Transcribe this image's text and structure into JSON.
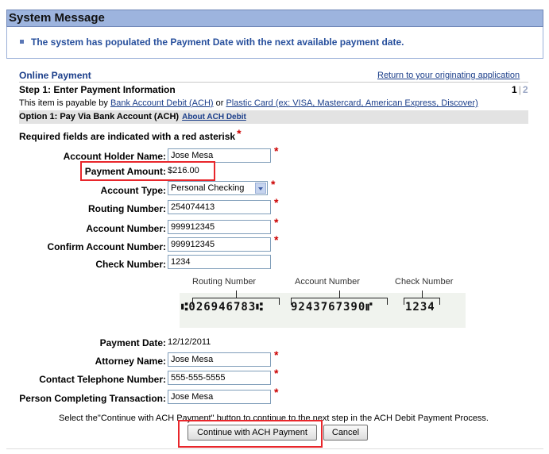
{
  "system_message": {
    "title": "System Message",
    "text": "The system has populated the Payment Date with the next available payment date."
  },
  "online_payment": {
    "title": "Online Payment",
    "return_link": "Return to your originating application",
    "step": "Step 1: Enter Payment Information",
    "page_current": "1",
    "page_sep": "|",
    "page_next": "2",
    "payable_prefix": "This item is payable by ",
    "ach_link": "Bank Account Debit (ACH)",
    "or_text": " or ",
    "card_link": "Plastic Card (ex: VISA, Mastercard, American Express, Discover)",
    "option_title": "Option 1: Pay Via Bank Account (ACH)",
    "about_link": "About ACH Debit",
    "required_note": "Required fields are indicated with a red asterisk",
    "asterisk": "*"
  },
  "form": {
    "account_holder_label": "Account Holder Name:",
    "account_holder_value": "Jose Mesa",
    "payment_amount_label": "Payment Amount:",
    "payment_amount_value": "$216.00",
    "account_type_label": "Account Type:",
    "account_type_value": "Personal Checking",
    "routing_label": "Routing Number:",
    "routing_value": "254074413",
    "account_number_label": "Account Number:",
    "account_number_value": "999912345",
    "confirm_account_label": "Confirm Account Number:",
    "confirm_account_value": "999912345",
    "check_number_label": "Check Number:",
    "check_number_value": "1234",
    "payment_date_label": "Payment Date:",
    "payment_date_value": "12/12/2011",
    "attorney_label": "Attorney Name:",
    "attorney_value": "Jose Mesa",
    "telephone_label": "Contact Telephone Number:",
    "telephone_value": "555-555-5555",
    "person_label": "Person Completing Transaction:",
    "person_value": "Jose Mesa"
  },
  "check_image": {
    "routing_label": "Routing Number",
    "account_label": "Account Number",
    "check_label": "Check Number",
    "routing_digits": "⑆026946783⑆",
    "account_digits": "9243767390⑈",
    "check_digits": "1234"
  },
  "footer": {
    "instruction": "Select the\"Continue with ACH Payment\" button to continue to the next step in the ACH Debit Payment Process.",
    "continue_button": "Continue with ACH Payment",
    "cancel_button": "Cancel"
  },
  "colors": {
    "header_bar": "#9db4de",
    "link": "#1b3e8a",
    "highlight_box": "#e8262b",
    "asterisk": "#cc0000"
  }
}
